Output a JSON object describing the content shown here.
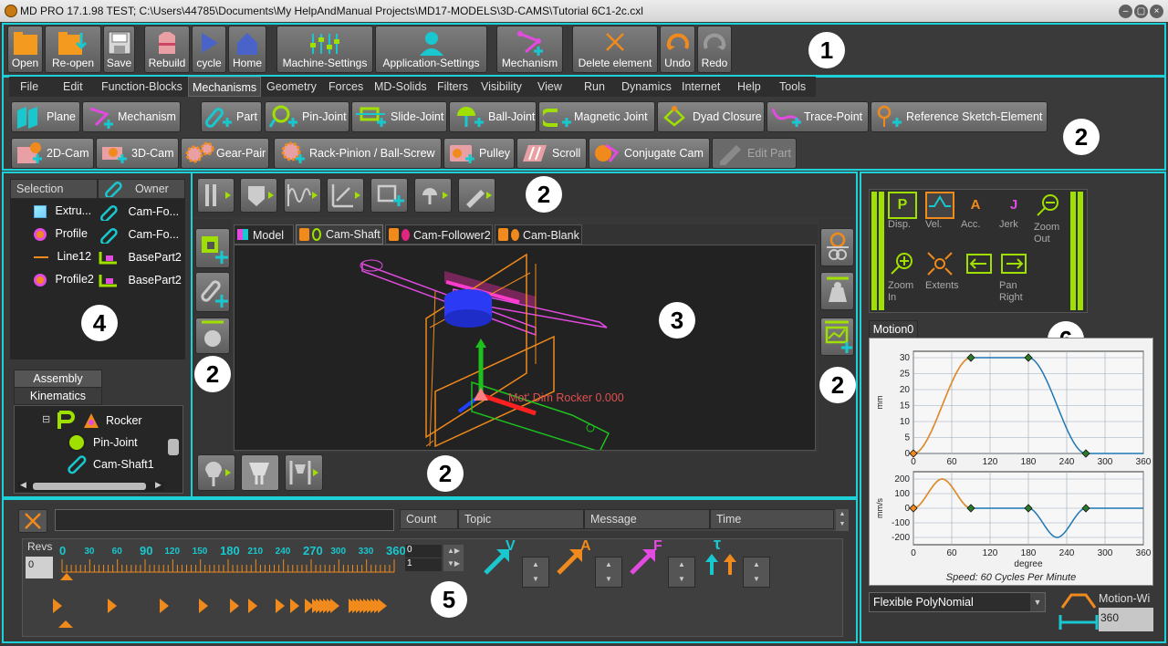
{
  "window": {
    "title": "MD PRO 17.1.98  TEST; C:\\Users\\44785\\Documents\\My HelpAndManual Projects\\MD17-MODELS\\3D-CAMS\\Tutorial 6C1-2c.cxl"
  },
  "toolbar": {
    "open": "Open",
    "reopen": "Re-open",
    "save": "Save",
    "rebuild": "Rebuild",
    "cycle": "cycle",
    "home": "Home",
    "machine_settings": "Machine-Settings",
    "application_settings": "Application-Settings",
    "mechanism": "Mechanism",
    "delete_element": "Delete element",
    "undo": "Undo",
    "redo": "Redo"
  },
  "menus": [
    "File",
    "Edit",
    "Function-Blocks",
    "Mechanisms",
    "Geometry",
    "Forces",
    "MD-Solids",
    "Filters",
    "Visibility",
    "View",
    "Run",
    "Dynamics",
    "Internet",
    "Help",
    "Tools"
  ],
  "ribbon": {
    "row1": [
      "Plane",
      "Mechanism",
      "Part",
      "Pin-Joint",
      "Slide-Joint",
      "Ball-Joint",
      "Magnetic Joint",
      "Dyad Closure",
      "Trace-Point",
      "Reference Sketch-Element"
    ],
    "row2": [
      "2D-Cam",
      "3D-Cam",
      "Gear-Pair",
      "Rack-Pinion / Ball-Screw",
      "Pulley",
      "Scroll",
      "Conjugate Cam",
      "Edit Part"
    ]
  },
  "selection": {
    "header_selection": "Selection",
    "header_owner": "Owner",
    "rows": [
      {
        "sel": "Extru...",
        "owner": "Cam-Fo..."
      },
      {
        "sel": "Profile",
        "owner": "Cam-Fo..."
      },
      {
        "sel": "Line12",
        "owner": "BasePart2"
      },
      {
        "sel": "Profile2",
        "owner": "BasePart2"
      }
    ]
  },
  "tree": {
    "tab_assembly": "Assembly",
    "tab_kinematics": "Kinematics",
    "items": [
      "Rocker",
      "Pin-Joint",
      "Cam-Shaft1"
    ],
    "expander": "⊟"
  },
  "view3d": {
    "tabs": [
      "Model",
      "Cam-Shaft",
      "Cam-Follower2",
      "Cam-Blank"
    ],
    "dim_label": "Mot' Dim Rocker 0.000"
  },
  "callouts": [
    "1",
    "2",
    "2",
    "3",
    "4",
    "2",
    "2",
    "2",
    "5",
    "6"
  ],
  "motion": {
    "buttons": [
      "Disp.",
      "Vel.",
      "Acc.",
      "Jerk",
      "Zoom Out",
      "Zoom In",
      "Extents",
      "",
      "Pan Right"
    ],
    "btn_letters": [
      "P",
      "V",
      "A",
      "J"
    ],
    "tab": "Motion0",
    "speed": "Speed: 60 Cycles Per Minute",
    "law": "Flexible PolyNomial",
    "motion_width_label": "Motion-Wi",
    "motion_width_value": "360",
    "xlabel": "degree",
    "ylabel_top": "mm",
    "ylabel_bottom": "mm/s"
  },
  "chart_data": [
    {
      "type": "line",
      "x": [
        0,
        90,
        180,
        270,
        360
      ],
      "series": [
        {
          "values": [
            0,
            30,
            30,
            0,
            0
          ]
        }
      ],
      "x_ticks": [
        "0",
        "60",
        "120",
        "180",
        "240",
        "300",
        "360"
      ],
      "y_ticks": [
        "0",
        "5",
        "10",
        "15",
        "20",
        "25",
        "30"
      ],
      "ylim": [
        0,
        32
      ],
      "xlim": [
        0,
        360
      ],
      "xlabel": "",
      "ylabel": "mm"
    },
    {
      "type": "line",
      "x": [
        0,
        45,
        90,
        135,
        180,
        225,
        270,
        360
      ],
      "series": [
        {
          "values": [
            0,
            200,
            0,
            0,
            0,
            -200,
            0,
            0
          ]
        }
      ],
      "x_ticks": [
        "0",
        "60",
        "120",
        "180",
        "240",
        "300",
        "360"
      ],
      "y_ticks": [
        "200",
        "100",
        "0",
        "-100",
        "-200"
      ],
      "ylim": [
        -250,
        250
      ],
      "xlim": [
        0,
        360
      ],
      "xlabel": "degree",
      "ylabel": "mm/s"
    }
  ],
  "messages": {
    "headers": [
      "Count",
      "Topic",
      "Message",
      "Time"
    ]
  },
  "timeline": {
    "revs_label": "Revs",
    "revs_value": "0",
    "scale": [
      "0",
      "30",
      "60",
      "90",
      "120",
      "150",
      "180",
      "210",
      "240",
      "270",
      "300",
      "330",
      "360"
    ],
    "spin1": "0",
    "spin2": "1",
    "vec_letters": [
      "V",
      "A",
      "F",
      "τ"
    ]
  },
  "colors": {
    "accent": "#1ed0d8",
    "orange": "#f08a1c",
    "lime": "#9fe000",
    "magenta": "#e24ae0"
  }
}
